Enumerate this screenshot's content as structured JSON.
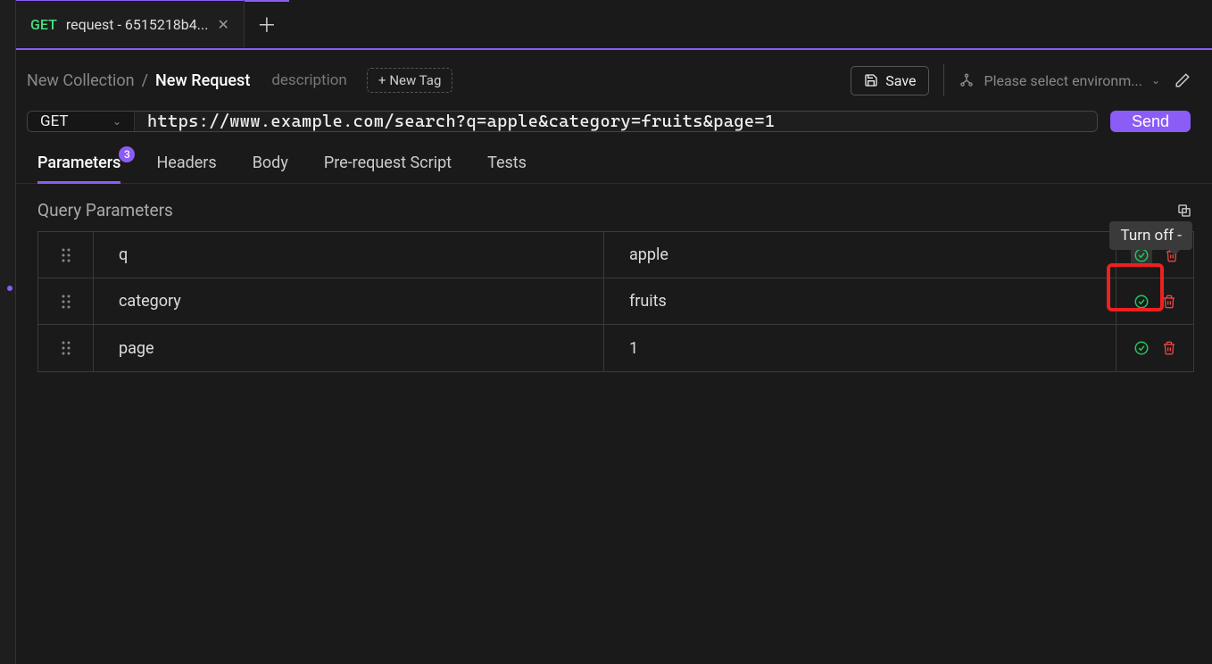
{
  "tab": {
    "method": "GET",
    "title": "request - 6515218b4..."
  },
  "breadcrumb": {
    "parent": "New Collection",
    "current": "New Request"
  },
  "description_placeholder": "description",
  "new_tag_label": "New Tag",
  "save_label": "Save",
  "env_placeholder": "Please select environm...",
  "method": "GET",
  "url": "https://www.example.com/search?q=apple&category=fruits&page=1",
  "send_label": "Send",
  "request_tabs": {
    "parameters": "Parameters",
    "headers": "Headers",
    "body": "Body",
    "pre_request": "Pre-request Script",
    "tests": "Tests"
  },
  "params_badge": "3",
  "section_title": "Query Parameters",
  "tooltip_text": "Turn off -",
  "params": [
    {
      "key": "q",
      "value": "apple"
    },
    {
      "key": "category",
      "value": "fruits"
    },
    {
      "key": "page",
      "value": "1"
    }
  ]
}
